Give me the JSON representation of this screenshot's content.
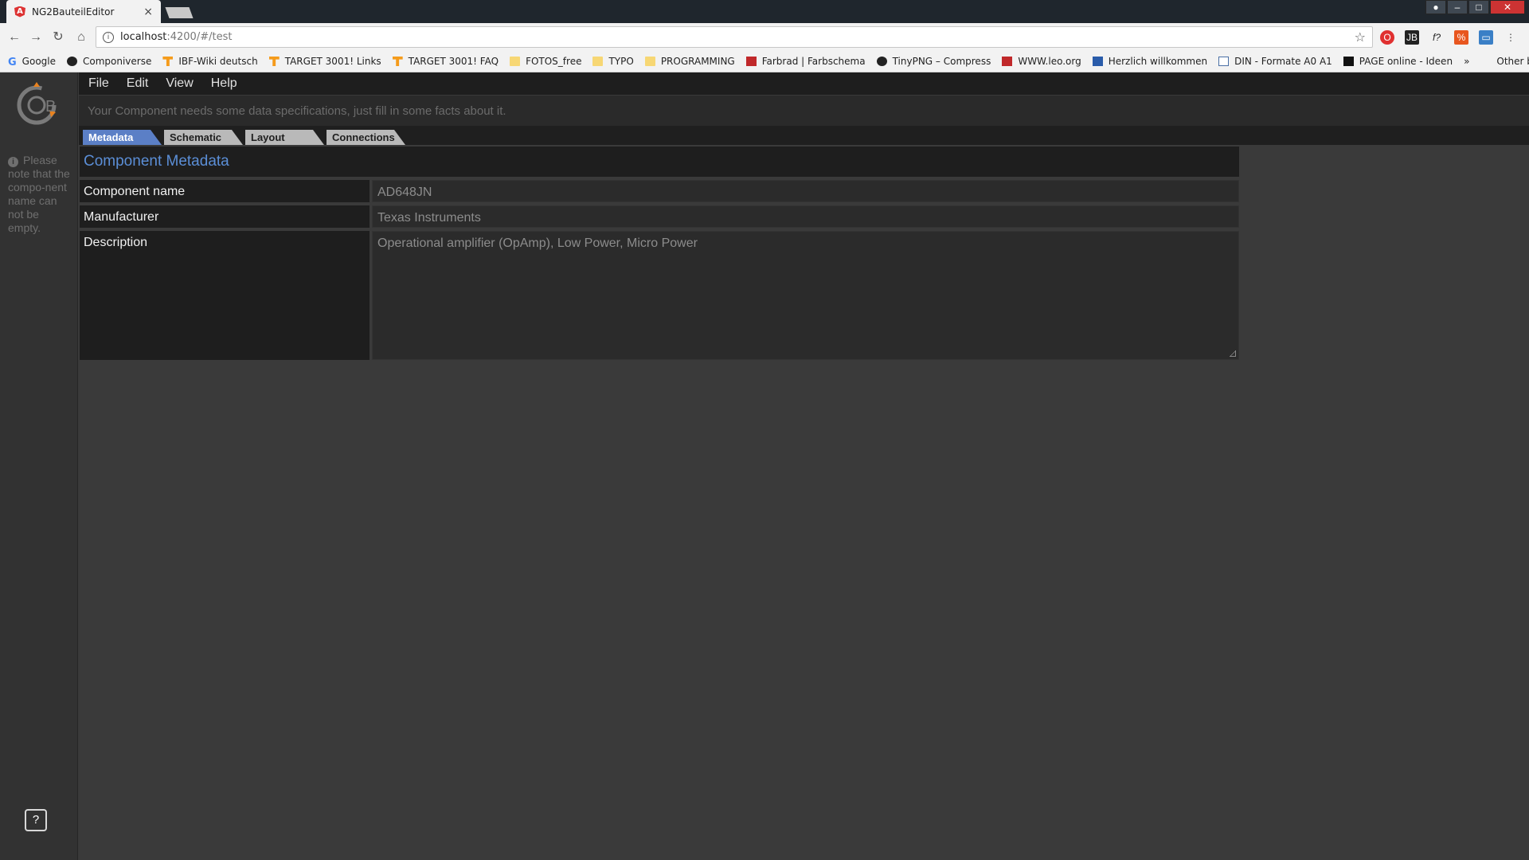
{
  "browser": {
    "tab_title": "NG2BauteilEditor",
    "tab_close": "×",
    "url_host": "localhost",
    "url_path": ":4200/#/test",
    "bookmarks": [
      {
        "label": "Google",
        "icon": "google-icon"
      },
      {
        "label": "Componiverse",
        "icon": "dot-icon"
      },
      {
        "label": "IBF-Wiki deutsch",
        "icon": "target-icon"
      },
      {
        "label": "TARGET 3001! Links",
        "icon": "target-icon"
      },
      {
        "label": "TARGET 3001! FAQ",
        "icon": "target-icon"
      },
      {
        "label": "FOTOS_free",
        "icon": "folder-icon"
      },
      {
        "label": "TYPO",
        "icon": "folder-icon"
      },
      {
        "label": "PROGRAMMING",
        "icon": "folder-icon"
      },
      {
        "label": "Farbrad | Farbschema",
        "icon": "adobe-icon"
      },
      {
        "label": "TinyPNG – Compress",
        "icon": "panda-icon"
      },
      {
        "label": "WWW.leo.org",
        "icon": "leo-icon"
      },
      {
        "label": "Herzlich willkommen",
        "icon": "eye-icon"
      },
      {
        "label": "DIN - Formate A0 A1",
        "icon": "doc-icon"
      },
      {
        "label": "PAGE online - Ideen",
        "icon": "page-icon"
      }
    ],
    "bookmarks_more": "»",
    "other_bookmarks": "Other bookmarks"
  },
  "sidebar": {
    "note": "Please note that the compo-nent name can not be empty.",
    "help_label": "?"
  },
  "menu": {
    "items": [
      "File",
      "Edit",
      "View",
      "Help"
    ]
  },
  "info_text": "Your Component needs some data specifications, just fill in some facts about it.",
  "tabs": [
    {
      "label": "Metadata",
      "active": true
    },
    {
      "label": "Schematic",
      "active": false
    },
    {
      "label": "Layout",
      "active": false
    },
    {
      "label": "Connections",
      "active": false
    }
  ],
  "metadata": {
    "title": "Component Metadata",
    "fields": [
      {
        "label": "Component name",
        "value": "AD648JN"
      },
      {
        "label": "Manufacturer",
        "value": "Texas Instruments"
      },
      {
        "label": "Description",
        "value": "Operational amplifier (OpAmp), Low Power, Micro Power"
      }
    ]
  },
  "colors": {
    "accent": "#5b7fc6",
    "title_blue": "#5b8ed6",
    "background": "#3a3a3a"
  }
}
